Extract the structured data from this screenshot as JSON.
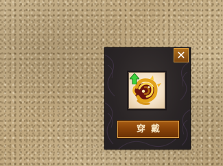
{
  "popup": {
    "close_glyph": "✕",
    "close_icon": "close-icon",
    "item_icon": "golden-dragon-armor-icon",
    "upgrade_indicator_icon": "green-up-arrow-icon",
    "equip_label": "穿戴"
  },
  "colors": {
    "panel_bg": "#2a2526",
    "button_bg": "#8a4409",
    "button_border": "#e0a348",
    "upgrade_arrow": "#3cd23c"
  }
}
